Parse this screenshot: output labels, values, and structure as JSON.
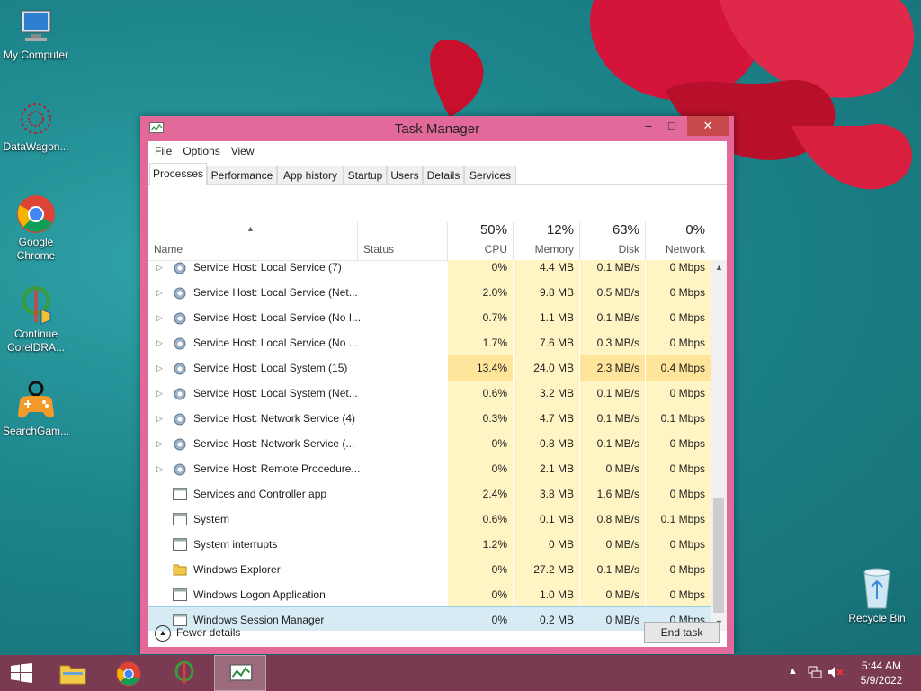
{
  "desktop": {
    "icons": [
      {
        "label": "My Computer"
      },
      {
        "label": "DataWagon..."
      },
      {
        "label": "Google Chrome"
      },
      {
        "label": "Continue CorelDRA..."
      },
      {
        "label": "SearchGam..."
      },
      {
        "label": "Recycle Bin"
      }
    ]
  },
  "window": {
    "title": "Task Manager",
    "menu": [
      "File",
      "Options",
      "View"
    ],
    "tabs": [
      "Processes",
      "Performance",
      "App history",
      "Startup",
      "Users",
      "Details",
      "Services"
    ],
    "active_tab": "Processes",
    "columns": {
      "name": "Name",
      "status": "Status",
      "cpu": {
        "pct": "50%",
        "label": "CPU"
      },
      "memory": {
        "pct": "12%",
        "label": "Memory"
      },
      "disk": {
        "pct": "63%",
        "label": "Disk"
      },
      "network": {
        "pct": "0%",
        "label": "Network"
      }
    },
    "rows": [
      {
        "name": "Service Host: Local Service (7)",
        "cpu": "0%",
        "mem": "4.4 MB",
        "disk": "0.1 MB/s",
        "net": "0 Mbps",
        "expandable": true,
        "icon": "gear-icon"
      },
      {
        "name": "Service Host: Local Service (Net...",
        "cpu": "2.0%",
        "mem": "9.8 MB",
        "disk": "0.5 MB/s",
        "net": "0 Mbps",
        "expandable": true,
        "icon": "gear-icon"
      },
      {
        "name": "Service Host: Local Service (No I...",
        "cpu": "0.7%",
        "mem": "1.1 MB",
        "disk": "0.1 MB/s",
        "net": "0 Mbps",
        "expandable": true,
        "icon": "gear-icon"
      },
      {
        "name": "Service Host: Local Service (No ...",
        "cpu": "1.7%",
        "mem": "7.6 MB",
        "disk": "0.3 MB/s",
        "net": "0 Mbps",
        "expandable": true,
        "icon": "gear-icon"
      },
      {
        "name": "Service Host: Local System (15)",
        "cpu": "13.4%",
        "mem": "24.0 MB",
        "disk": "2.3 MB/s",
        "net": "0.4 Mbps",
        "expandable": true,
        "icon": "gear-icon",
        "hot": true
      },
      {
        "name": "Service Host: Local System (Net...",
        "cpu": "0.6%",
        "mem": "3.2 MB",
        "disk": "0.1 MB/s",
        "net": "0 Mbps",
        "expandable": true,
        "icon": "gear-icon"
      },
      {
        "name": "Service Host: Network Service (4)",
        "cpu": "0.3%",
        "mem": "4.7 MB",
        "disk": "0.1 MB/s",
        "net": "0.1 Mbps",
        "expandable": true,
        "icon": "gear-icon"
      },
      {
        "name": "Service Host: Network Service (...",
        "cpu": "0%",
        "mem": "0.8 MB",
        "disk": "0.1 MB/s",
        "net": "0 Mbps",
        "expandable": true,
        "icon": "gear-icon"
      },
      {
        "name": "Service Host: Remote Procedure...",
        "cpu": "0%",
        "mem": "2.1 MB",
        "disk": "0 MB/s",
        "net": "0 Mbps",
        "expandable": true,
        "icon": "gear-icon"
      },
      {
        "name": "Services and Controller app",
        "cpu": "2.4%",
        "mem": "3.8 MB",
        "disk": "1.6 MB/s",
        "net": "0 Mbps",
        "expandable": false,
        "icon": "app-window-icon"
      },
      {
        "name": "System",
        "cpu": "0.6%",
        "mem": "0.1 MB",
        "disk": "0.8 MB/s",
        "net": "0.1 Mbps",
        "expandable": false,
        "icon": "app-window-icon"
      },
      {
        "name": "System interrupts",
        "cpu": "1.2%",
        "mem": "0 MB",
        "disk": "0 MB/s",
        "net": "0 Mbps",
        "expandable": false,
        "icon": "app-window-icon"
      },
      {
        "name": "Windows Explorer",
        "cpu": "0%",
        "mem": "27.2 MB",
        "disk": "0.1 MB/s",
        "net": "0 Mbps",
        "expandable": false,
        "icon": "folder-icon"
      },
      {
        "name": "Windows Logon Application",
        "cpu": "0%",
        "mem": "1.0 MB",
        "disk": "0 MB/s",
        "net": "0 Mbps",
        "expandable": false,
        "icon": "app-window-icon"
      },
      {
        "name": "Windows Session Manager",
        "cpu": "0%",
        "mem": "0.2 MB",
        "disk": "0 MB/s",
        "net": "0 Mbps",
        "expandable": false,
        "icon": "app-window-icon",
        "selected": true
      }
    ],
    "fewer_details": "Fewer details",
    "end_task": "End task"
  },
  "taskbar": {
    "time": "5:44 AM",
    "date": "5/9/2022"
  },
  "colors": {
    "window_frame": "#e3699a",
    "close_button": "#c7494a",
    "taskbar": "#7a3a52",
    "heat_light": "#fff4c4",
    "heat_strong": "#ffe59b",
    "selection": "#d7ebf5"
  }
}
